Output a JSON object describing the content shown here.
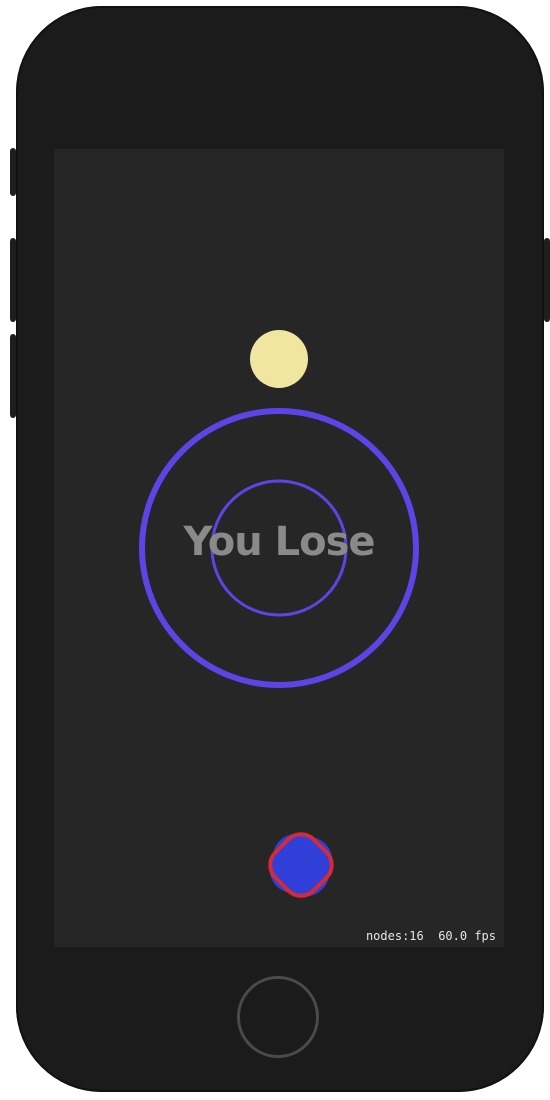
{
  "game": {
    "status_text": "You Lose",
    "stats": {
      "nodes": "nodes:16",
      "fps": "60.0 fps"
    }
  },
  "colors": {
    "ring": "#5b45e6",
    "ball": "#f0e6a0",
    "player_blue": "#2f3fd8",
    "player_red": "#d42a3a",
    "text": "#8a8a8a",
    "screen_bg": "#262626",
    "phone_body": "#1b1b1b"
  },
  "icons": {
    "player": "rounded-square-player-icon",
    "home": "home-button-icon"
  }
}
